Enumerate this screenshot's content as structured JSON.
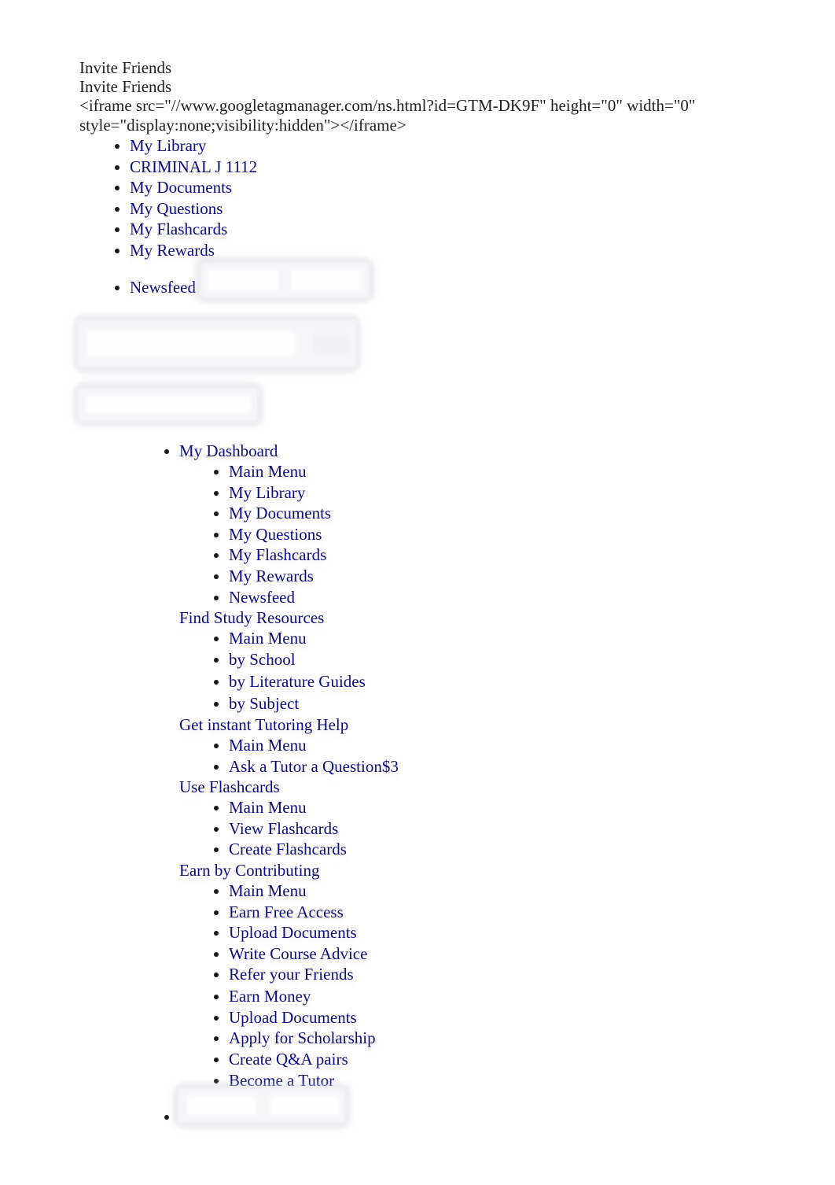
{
  "header": {
    "invite_line_1": "Invite Friends",
    "invite_line_2": "Invite Friends",
    "noscript_iframe_text": "<iframe src=\"//www.googletagmanager.com/ns.html?id=GTM-DK9F\" height=\"0\" width=\"0\" style=\"display:none;visibility:hidden\"></iframe>"
  },
  "top_menu": {
    "items": [
      {
        "label": "My Library"
      },
      {
        "label": "CRIMINAL J 1112"
      },
      {
        "label": "My Documents"
      },
      {
        "label": "My Questions"
      },
      {
        "label": "My Flashcards"
      },
      {
        "label": "My Rewards"
      },
      {
        "label": "Newsfeed"
      }
    ]
  },
  "search": {
    "placeholder": "",
    "button_label": ""
  },
  "nav": {
    "dashboard_label": "My Dashboard",
    "dashboard_items": [
      {
        "label": "Main Menu"
      },
      {
        "label": "My Library"
      },
      {
        "label": "My Documents"
      },
      {
        "label": "My Questions"
      },
      {
        "label": "My Flashcards"
      },
      {
        "label": "My Rewards"
      },
      {
        "label": "Newsfeed"
      }
    ],
    "groups": [
      {
        "label": "Find Study Resources",
        "items": [
          {
            "label": "Main Menu"
          },
          {
            "label": "by School"
          },
          {
            "label": "by Literature Guides"
          },
          {
            "label": "by Subject"
          }
        ]
      },
      {
        "label": "Get instant Tutoring Help",
        "items": [
          {
            "label": "Main Menu"
          },
          {
            "label": "Ask a Tutor a Question$3"
          }
        ]
      },
      {
        "label": "Use Flashcards",
        "items": [
          {
            "label": "Main Menu"
          },
          {
            "label": "View Flashcards"
          },
          {
            "label": "Create Flashcards"
          }
        ]
      },
      {
        "label": "Earn by Contributing",
        "items": [
          {
            "label": "Main Menu"
          },
          {
            "label": "Earn Free Access"
          },
          {
            "label": "Upload Documents"
          },
          {
            "label": "Write Course Advice"
          },
          {
            "label": "Refer your Friends"
          },
          {
            "label": "Earn Money"
          },
          {
            "label": "Upload Documents"
          },
          {
            "label": "Apply for Scholarship"
          },
          {
            "label": "Create Q&A pairs"
          },
          {
            "label": "Become a Tutor"
          }
        ]
      }
    ]
  }
}
